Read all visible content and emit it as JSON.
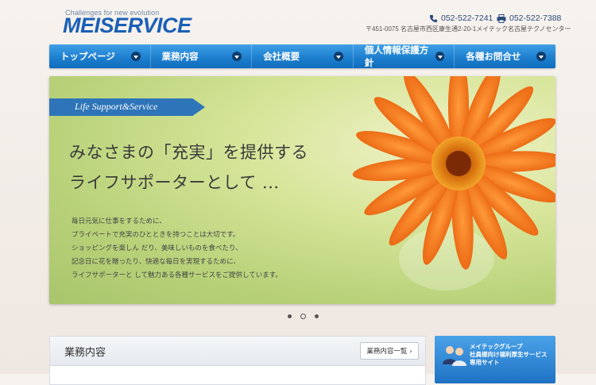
{
  "header": {
    "tagline": "Challenges for new evolution",
    "logo": "MEISERVICE",
    "phone": "052-522-7241",
    "fax": "052-522-7388",
    "address": "〒451-0075 名古屋市西区康生通2-20-1メイテック名古屋テクノセンター"
  },
  "nav": [
    "トップページ",
    "業務内容",
    "会社概要",
    "個人情報保護方針",
    "各種お問合せ"
  ],
  "hero": {
    "ribbon": "Life Support&Service",
    "headline_1": "みなさまの「充実」を提供する",
    "headline_2": "ライフサポーターとして ...",
    "body": [
      "毎日元気に仕事をするために、",
      "プライベートで充実のひとときを持つことは大切です。",
      "ショッピングを楽しん だり、美味しいものを食べたり、",
      "記念日に花を贈ったり、快適な毎日を実現するために、",
      "ライフサポーターと して魅力ある各種サービスをご提供しています。"
    ]
  },
  "slider": {
    "slides": 3,
    "active": 2
  },
  "services": {
    "title": "業務内容",
    "button": "業務内容一覧"
  },
  "banner": {
    "line1": "メイテックグループ",
    "line2": "社員様向け福利厚生サービス",
    "line3": "専用サイト"
  },
  "colors": {
    "brand": "#1b5fb6",
    "nav": "#1e7fcf",
    "flower": "#f07a1e"
  }
}
